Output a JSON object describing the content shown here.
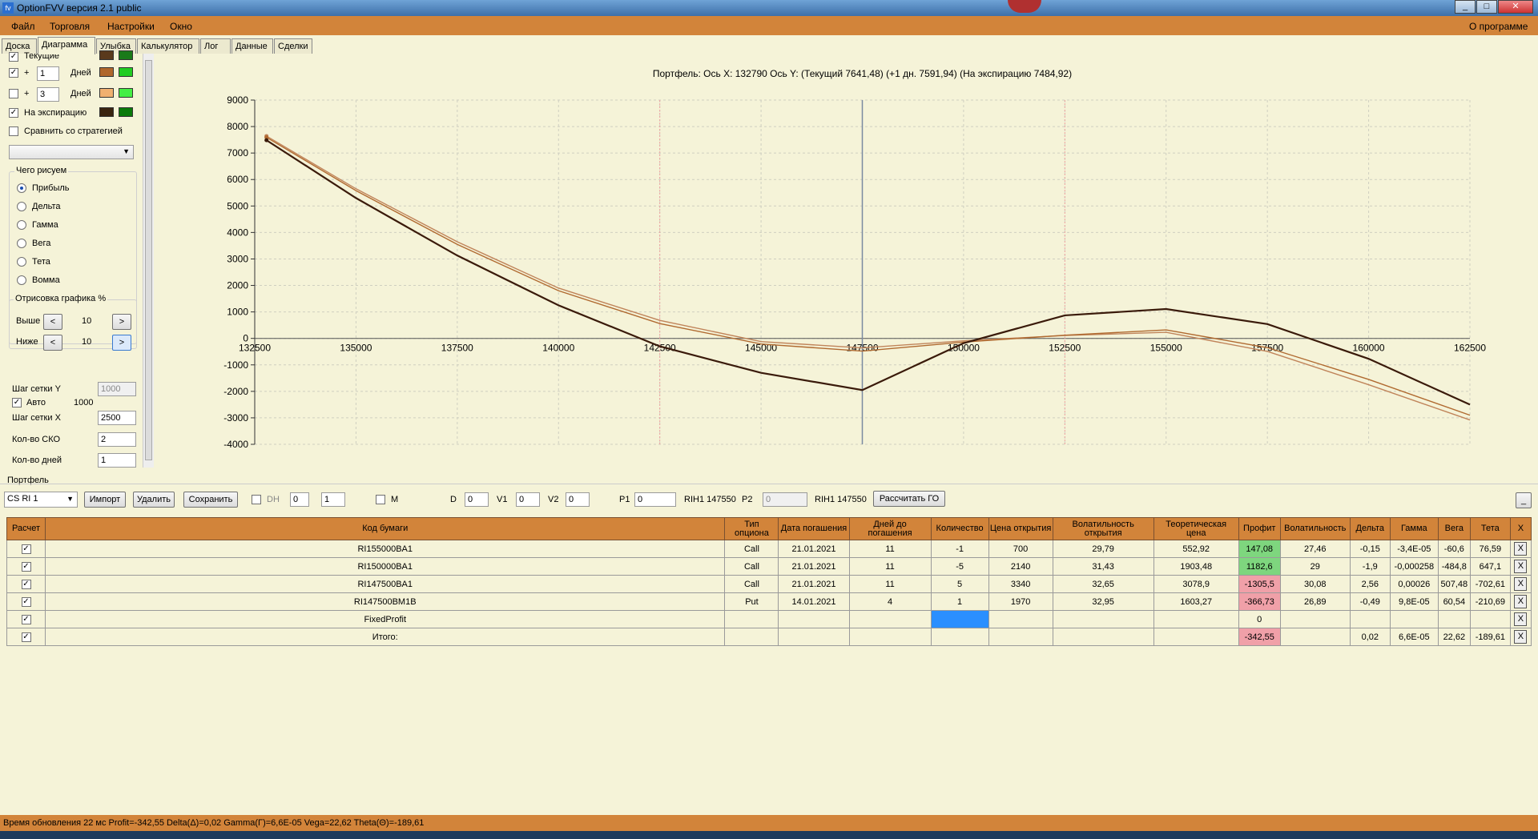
{
  "window": {
    "title": "OptionFVV версия 2.1 public"
  },
  "menu": {
    "file": "Файл",
    "trade": "Торговля",
    "settings": "Настройки",
    "window": "Окно",
    "about": "О программе"
  },
  "tabs": [
    "Доска",
    "Диаграмма",
    "Улыбка",
    "Калькулятор",
    "Лог",
    "Данные",
    "Сделки"
  ],
  "left": {
    "current": "Текущие",
    "plus": "+",
    "days1": "1",
    "days2": "3",
    "days_label": "Дней",
    "expiry": "На экспирацию",
    "compare": "Сравнить со стратегией",
    "draw_group": "Чего рисуем",
    "radios": [
      "Прибыль",
      "Дельта",
      "Гамма",
      "Вега",
      "Тета",
      "Вомма"
    ],
    "render_group": "Отрисовка графика %",
    "above": "Выше",
    "below": "Ниже",
    "above_val": "10",
    "below_val": "10",
    "lt": "<",
    "gt": ">",
    "grid_y": "Шаг сетки Y",
    "grid_y_val": "1000",
    "auto": "Авто",
    "auto_val": "1000",
    "grid_x": "Шаг сетки X",
    "grid_x_val": "2500",
    "sko": "Кол-во СКО",
    "sko_val": "2",
    "days_count": "Кол-во дней",
    "days_count_val": "1",
    "colors": {
      "cur_a": "#5a3a1c",
      "cur_b": "#1a7a1a",
      "d1_a": "#b0672c",
      "d1_b": "#22cc22",
      "d3_a": "#f0b070",
      "d3_b": "#44ee44",
      "exp_a": "#3a2410",
      "exp_b": "#0a7a0a"
    }
  },
  "chart_data": {
    "type": "line",
    "title": "Портфель: Ось X: 132790 Ось Y:  (Текущий 7641,48)  (+1 дн. 7591,94)  (На экспирацию 7484,92)",
    "xlim": [
      132500,
      162500
    ],
    "ylim": [
      -4000,
      9000
    ],
    "x_ticks": [
      "132500",
      "135000",
      "137500",
      "140000",
      "142500",
      "145000",
      "147500",
      "150000",
      "152500",
      "155000",
      "157500",
      "160000",
      "162500"
    ],
    "y_ticks": [
      "9000",
      "8000",
      "7000",
      "6000",
      "5000",
      "4000",
      "3000",
      "2000",
      "1000",
      "0",
      "-1000",
      "-2000",
      "-3000",
      "-4000"
    ],
    "cursor_x": 147500,
    "sd_lines": [
      142500,
      152500
    ],
    "series": [
      {
        "color": "#3a1a0a",
        "x": [
          132790,
          135000,
          137500,
          140000,
          142500,
          145000,
          147500,
          150000,
          152500,
          155000,
          157500,
          160000,
          162500
        ],
        "y": [
          7485,
          5300,
          3130,
          1250,
          -300,
          -1300,
          -1950,
          -180,
          870,
          1110,
          540,
          -770,
          -2500
        ]
      },
      {
        "color": "#b06a30",
        "x": [
          132790,
          135000,
          137500,
          140000,
          142500,
          145000,
          147500,
          150000,
          152500,
          155000,
          157500,
          160000,
          162500
        ],
        "y": [
          7592,
          5580,
          3550,
          1800,
          560,
          -210,
          -480,
          -140,
          120,
          320,
          -350,
          -1550,
          -2900
        ]
      },
      {
        "color": "#c0845a",
        "x": [
          132790,
          135000,
          137500,
          140000,
          142500,
          145000,
          147500,
          150000,
          152500,
          155000,
          157500,
          160000,
          162500
        ],
        "y": [
          7641,
          5650,
          3650,
          1900,
          680,
          -120,
          -360,
          -90,
          110,
          230,
          -490,
          -1750,
          -3080
        ]
      }
    ]
  },
  "portfolio": {
    "label": "Портфель",
    "select": "CS RI 1",
    "import": "Импорт",
    "delete": "Удалить",
    "save": "Сохранить",
    "dh": "DH",
    "s1": "0",
    "s2": "1",
    "m": "M",
    "d": "D",
    "d_val": "0",
    "v1": "V1",
    "v1_val": "0",
    "v2": "V2",
    "v2_val": "0",
    "p1": "P1",
    "p1_val": "0",
    "rih1": "RIH1 147550",
    "p2": "P2",
    "p2_val": "0",
    "rih2": "RIH1 147550",
    "go": "Рассчитать ГО",
    "minbtn": "_"
  },
  "table": {
    "headers": [
      "Расчет",
      "Код бумаги",
      "Тип опциона",
      "Дата погашения",
      "Дней до погашения",
      "Количество",
      "Цена открытия",
      "Волатильность открытия",
      "Теоретическая цена",
      "Профит",
      "Волатильность",
      "Дельта",
      "Гамма",
      "Вега",
      "Тета",
      "X"
    ],
    "rows": [
      [
        "RI155000BA1",
        "Call",
        "21.01.2021",
        "11",
        "-1",
        "700",
        "29,79",
        "552,92",
        "147,08",
        "27,46",
        "-0,15",
        "-3,4E-05",
        "-60,6",
        "76,59"
      ],
      [
        "RI150000BA1",
        "Call",
        "21.01.2021",
        "11",
        "-5",
        "2140",
        "31,43",
        "1903,48",
        "1182,6",
        "29",
        "-1,9",
        "-0,000258",
        "-484,8",
        "647,1"
      ],
      [
        "RI147500BA1",
        "Call",
        "21.01.2021",
        "11",
        "5",
        "3340",
        "32,65",
        "3078,9",
        "-1305,5",
        "30,08",
        "2,56",
        "0,00026",
        "507,48",
        "-702,61"
      ],
      [
        "RI147500BM1B",
        "Put",
        "14.01.2021",
        "4",
        "1",
        "1970",
        "32,95",
        "1603,27",
        "-366,73",
        "26,89",
        "-0,49",
        "9,8E-05",
        "60,54",
        "-210,69"
      ],
      [
        "FixedProfit",
        "",
        "",
        "",
        "",
        "",
        "",
        "",
        "0",
        "",
        "",
        "",
        "",
        ""
      ],
      [
        "Итого:",
        "",
        "",
        "",
        "",
        "",
        "",
        "",
        "-342,55",
        "",
        "0,02",
        "6,6E-05",
        "22,62",
        "-189,61"
      ]
    ],
    "x": "X",
    "check": "✓"
  },
  "status": "Время обновления 22 мс  Profit=-342,55 Delta(Δ)=0,02 Gamma(Γ)=6,6E-05 Vega=22,62 Theta(Θ)=-189,61"
}
